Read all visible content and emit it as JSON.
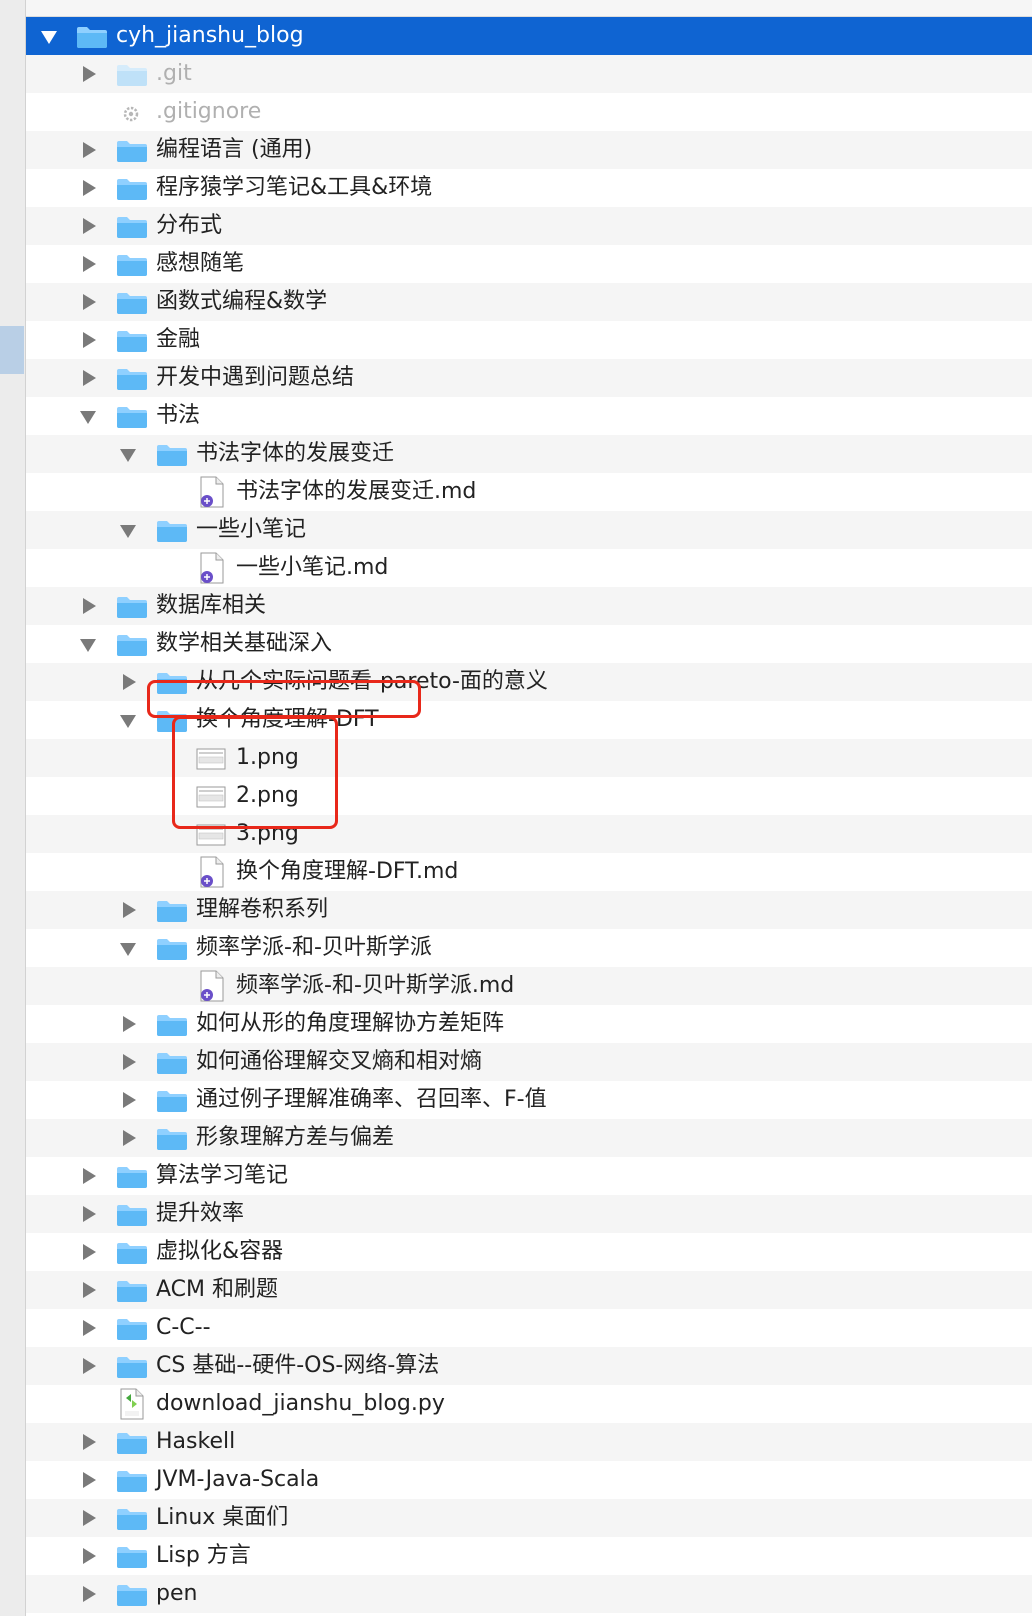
{
  "root": {
    "label": "cyh_jianshu_blog"
  },
  "rows": [
    {
      "label": ".git",
      "disclosure": "closed",
      "icon": "folder-icon",
      "dim": true
    },
    {
      "label": ".gitignore",
      "disclosure": "none",
      "icon": "gear-file-icon",
      "dim": true
    },
    {
      "label": "编程语言 (通用)",
      "disclosure": "closed",
      "icon": "folder-icon"
    },
    {
      "label": "程序猿学习笔记&工具&环境",
      "disclosure": "closed",
      "icon": "folder-icon"
    },
    {
      "label": "分布式",
      "disclosure": "closed",
      "icon": "folder-icon"
    },
    {
      "label": "感想随笔",
      "disclosure": "closed",
      "icon": "folder-icon"
    },
    {
      "label": "函数式编程&数学",
      "disclosure": "closed",
      "icon": "folder-icon"
    },
    {
      "label": "金融",
      "disclosure": "closed",
      "icon": "folder-icon"
    },
    {
      "label": "开发中遇到问题总结",
      "disclosure": "closed",
      "icon": "folder-icon"
    },
    {
      "label": "书法",
      "disclosure": "open",
      "icon": "folder-icon"
    },
    {
      "label": "书法字体的发展变迁",
      "disclosure": "open",
      "icon": "folder-icon",
      "depth": 1
    },
    {
      "label": "书法字体的发展变迁.md",
      "disclosure": "none",
      "icon": "markdown-file-icon",
      "depth": 2
    },
    {
      "label": "一些小笔记",
      "disclosure": "open",
      "icon": "folder-icon",
      "depth": 1
    },
    {
      "label": "一些小笔记.md",
      "disclosure": "none",
      "icon": "markdown-file-icon",
      "depth": 2
    },
    {
      "label": "数据库相关",
      "disclosure": "closed",
      "icon": "folder-icon"
    },
    {
      "label": "数学相关基础深入",
      "disclosure": "open",
      "icon": "folder-icon"
    },
    {
      "label": "从几个实际问题看-pareto-面的意义",
      "disclosure": "closed",
      "icon": "folder-icon",
      "depth": 1
    },
    {
      "label": "换个角度理解-DFT",
      "disclosure": "open",
      "icon": "folder-icon",
      "depth": 1
    },
    {
      "label": "1.png",
      "disclosure": "none",
      "icon": "image-file-icon",
      "depth": 2
    },
    {
      "label": "2.png",
      "disclosure": "none",
      "icon": "image-file-icon",
      "depth": 2
    },
    {
      "label": "3.png",
      "disclosure": "none",
      "icon": "image-file-icon",
      "depth": 2
    },
    {
      "label": "换个角度理解-DFT.md",
      "disclosure": "none",
      "icon": "markdown-file-icon",
      "depth": 2
    },
    {
      "label": "理解卷积系列",
      "disclosure": "closed",
      "icon": "folder-icon",
      "depth": 1
    },
    {
      "label": "频率学派-和-贝叶斯学派",
      "disclosure": "open",
      "icon": "folder-icon",
      "depth": 1
    },
    {
      "label": "频率学派-和-贝叶斯学派.md",
      "disclosure": "none",
      "icon": "markdown-file-icon",
      "depth": 2
    },
    {
      "label": "如何从形的角度理解协方差矩阵",
      "disclosure": "closed",
      "icon": "folder-icon",
      "depth": 1
    },
    {
      "label": "如何通俗理解交叉熵和相对熵",
      "disclosure": "closed",
      "icon": "folder-icon",
      "depth": 1
    },
    {
      "label": "通过例子理解准确率、召回率、F-值",
      "disclosure": "closed",
      "icon": "folder-icon",
      "depth": 1
    },
    {
      "label": "形象理解方差与偏差",
      "disclosure": "closed",
      "icon": "folder-icon",
      "depth": 1
    },
    {
      "label": "算法学习笔记",
      "disclosure": "closed",
      "icon": "folder-icon"
    },
    {
      "label": "提升效率",
      "disclosure": "closed",
      "icon": "folder-icon"
    },
    {
      "label": "虚拟化&容器",
      "disclosure": "closed",
      "icon": "folder-icon"
    },
    {
      "label": "ACM 和刷题",
      "disclosure": "closed",
      "icon": "folder-icon"
    },
    {
      "label": "C-C--",
      "disclosure": "closed",
      "icon": "folder-icon"
    },
    {
      "label": "CS 基础--硬件-OS-网络-算法",
      "disclosure": "closed",
      "icon": "folder-icon"
    },
    {
      "label": "download_jianshu_blog.py",
      "disclosure": "none",
      "icon": "python-file-icon"
    },
    {
      "label": "Haskell",
      "disclosure": "closed",
      "icon": "folder-icon"
    },
    {
      "label": "JVM-Java-Scala",
      "disclosure": "closed",
      "icon": "folder-icon"
    },
    {
      "label": "Linux 桌面们",
      "disclosure": "closed",
      "icon": "folder-icon"
    },
    {
      "label": "Lisp 方言",
      "disclosure": "closed",
      "icon": "folder-icon"
    },
    {
      "label": "pen",
      "disclosure": "closed",
      "icon": "folder-icon"
    }
  ],
  "colors": {
    "selection": "#0f64d2",
    "folder": "#4aa8ec",
    "highlight_annotation": "#e8281a",
    "stripe": "#f5f5f5"
  }
}
